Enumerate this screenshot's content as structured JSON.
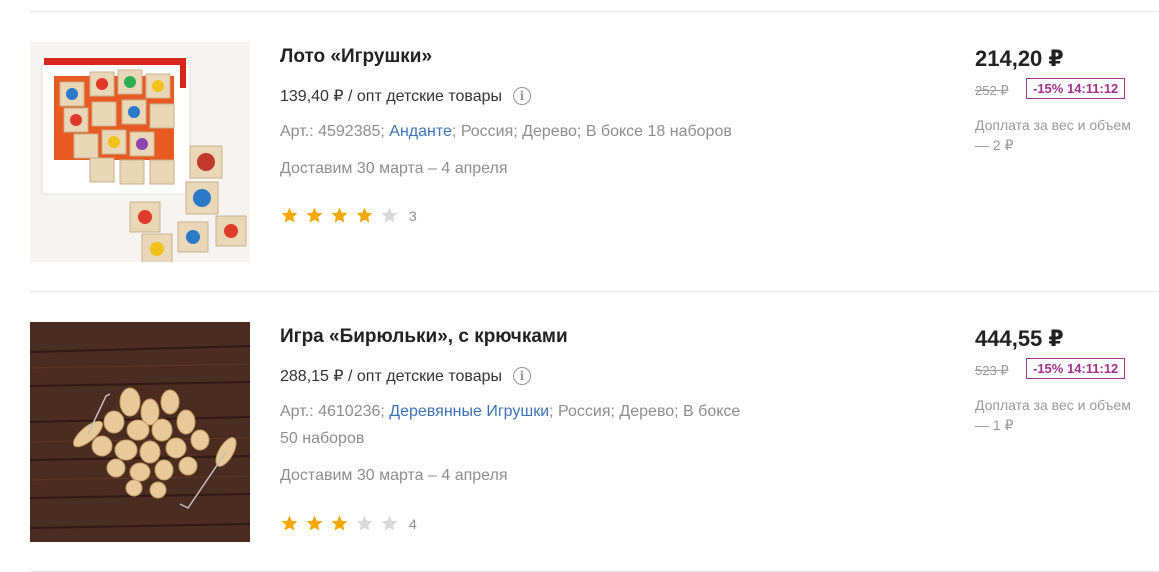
{
  "products": [
    {
      "title": "Лото «Игрушки»",
      "wholesale_price": "139,40 ₽ / опт детские товары",
      "info_icon": "info-icon",
      "meta_article": "Арт.: 4592385; ",
      "meta_brand": "Анданте",
      "meta_rest": "; Россия; Дерево; В боксе 18 наборов",
      "delivery": "Доставим 30 марта – 4 апреля",
      "rating": 4,
      "rating_count": "3",
      "price": "214,20 ₽",
      "old_price": "252 ₽",
      "discount": "-15% 14:11:12",
      "surcharge": "Доплата за вес и объем — 2 ₽",
      "image_icon": "wooden-lotto-cards-image"
    },
    {
      "title": "Игра «Бирюльки», с крючками",
      "wholesale_price": "288,15 ₽ / опт детские товары",
      "info_icon": "info-icon",
      "meta_article": "Арт.: 4610236; ",
      "meta_brand": "Деревянные Игрушки",
      "meta_rest": "; Россия; Дерево; В боксе 50 наборов",
      "delivery": "Доставим 30 марта – 4 апреля",
      "rating": 3,
      "rating_count": "4",
      "price": "444,55 ₽",
      "old_price": "523 ₽",
      "discount": "-15% 14:11:12",
      "surcharge": "Доплата за вес и объем — 1 ₽",
      "image_icon": "wooden-biryulki-image"
    }
  ],
  "colors": {
    "star_filled": "#f5a800",
    "star_empty": "#d9d9d9",
    "link": "#3d74b8",
    "discount": "#a0328c"
  }
}
